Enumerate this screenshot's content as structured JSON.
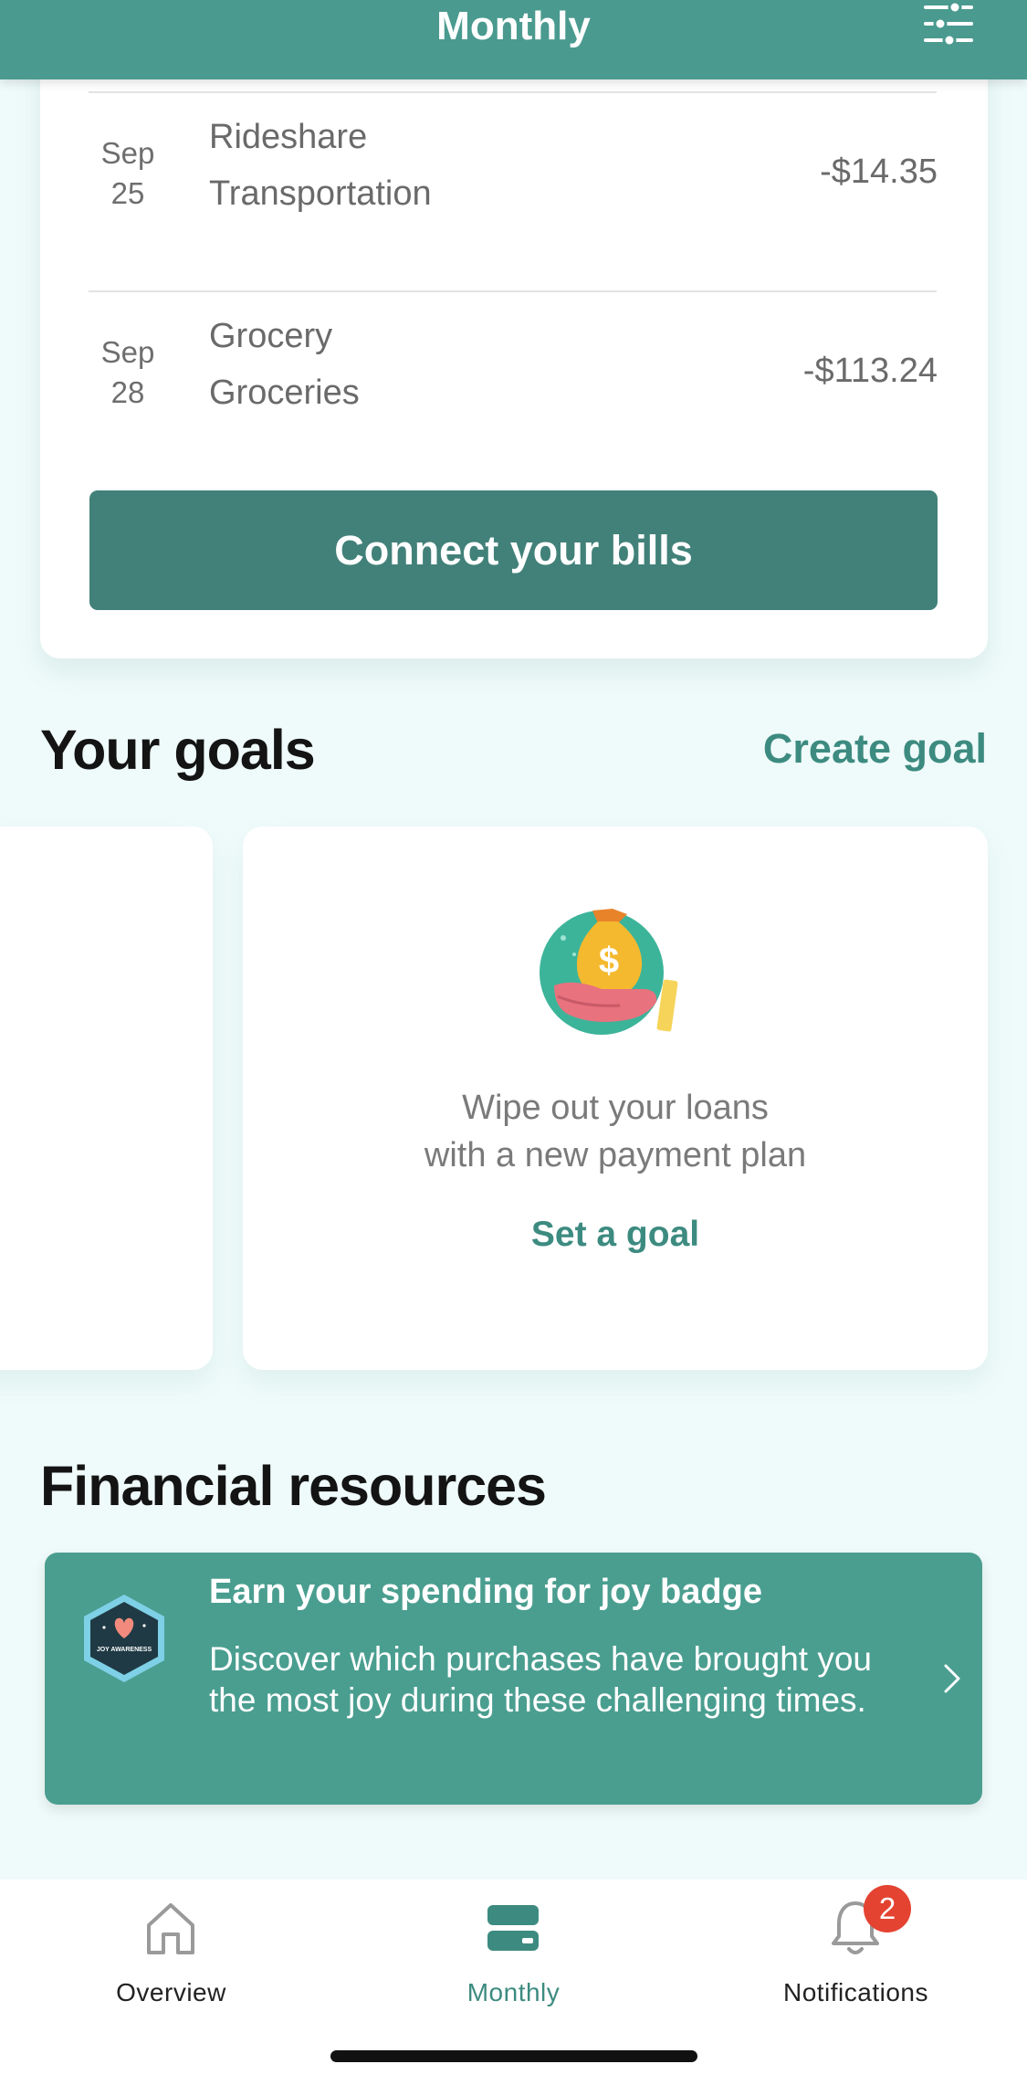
{
  "header": {
    "title": "Monthly"
  },
  "transactions": [
    {
      "month": "Sep",
      "day": "25",
      "merchant": "Rideshare",
      "category": "Transportation",
      "amount": "-$14.35"
    },
    {
      "month": "Sep",
      "day": "28",
      "merchant": "Grocery",
      "category": "Groceries",
      "amount": "-$113.24"
    }
  ],
  "connect_bills_label": "Connect your bills",
  "goals": {
    "title": "Your goals",
    "create_label": "Create goal",
    "card": {
      "line1": "Wipe out your loans",
      "line2": "with a new payment plan",
      "action": "Set a goal"
    }
  },
  "resources": {
    "title": "Financial resources",
    "card": {
      "badge_text": "JOY AWARENESS",
      "title": "Earn your spending for joy badge",
      "body": "Discover which purchases have brought you the most joy during these challenging times."
    }
  },
  "nav": {
    "items": [
      {
        "label": "Overview",
        "icon": "home-icon",
        "active": false
      },
      {
        "label": "Monthly",
        "icon": "monthly-icon",
        "active": true
      },
      {
        "label": "Notifications",
        "icon": "bell-icon",
        "active": false,
        "badge": "2"
      }
    ]
  },
  "colors": {
    "header": "#4A9A8F",
    "accent": "#3D8B80",
    "button": "#418179",
    "resource_card": "#4A9E90",
    "background": "#EFFBFA",
    "badge": "#E44332"
  }
}
